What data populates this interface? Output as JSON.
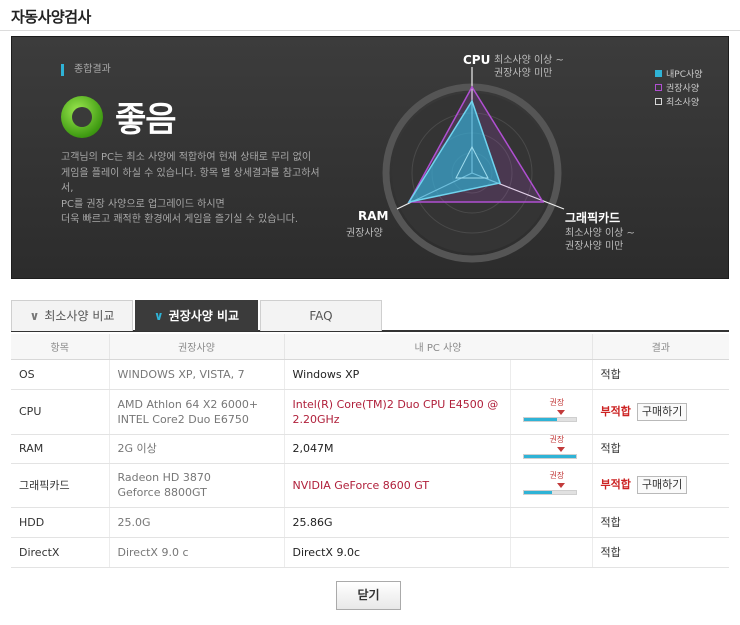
{
  "page_title": "자동사양검사",
  "summary": {
    "label": "종합결과",
    "result": "좋음",
    "description": "고객님의 PC는 최소 사양에 적합하여 현재 상태로 무리 없이\n게임을 플레이 하실 수 있습니다. 항목 별 상세결과를 참고하셔서,\nPC를 권장 사양으로 업그레이드 하시면\n더욱 빠르고 쾌적한 환경에서 게임을 즐기실 수 있습니다."
  },
  "radar": {
    "axes": [
      {
        "name": "CPU",
        "note": "최소사양 이상 ~\n권장사양 미만"
      },
      {
        "name": "그래픽카드",
        "note": "최소사양 이상 ~\n권장사양 미만"
      },
      {
        "name": "RAM",
        "note": "권장사양"
      }
    ],
    "legend": [
      {
        "label": "내PC사양",
        "color": "#2fb3d6"
      },
      {
        "label": "권장사양",
        "color": "#b04fd2"
      },
      {
        "label": "최소사양",
        "color": "#d8d8d8"
      }
    ]
  },
  "tabs": [
    {
      "label": "최소사양 비교"
    },
    {
      "label": "권장사양 비교"
    },
    {
      "label": "FAQ"
    }
  ],
  "table": {
    "headers": {
      "item": "항목",
      "recommended": "권장사양",
      "mine": "내 PC 사양",
      "result": "결과"
    },
    "rows": [
      {
        "item": "OS",
        "recommended": "WINDOWS XP,  VISTA,  7",
        "mine": "Windows XP",
        "meter": false,
        "result": "적합",
        "buy": ""
      },
      {
        "item": "CPU",
        "recommended": "AMD Athlon 64 X2 6000+\nINTEL Core2 Duo E6750",
        "mine": "Intel(R) Core(TM)2 Duo CPU E4500 @\n2.20GHz",
        "meter": true,
        "meter_label": "권장",
        "meter_level": 0.65,
        "result": "부적합",
        "buy": "구매하기"
      },
      {
        "item": "RAM",
        "recommended": "2G 이상",
        "mine": "2,047M",
        "meter": true,
        "meter_label": "권장",
        "meter_level": 1.0,
        "result": "적합",
        "buy": ""
      },
      {
        "item": "그래픽카드",
        "recommended": "Radeon HD 3870\nGeforce 8800GT",
        "mine": "NVIDIA GeForce 8600 GT",
        "meter": true,
        "meter_label": "권장",
        "meter_level": 0.55,
        "result": "부적합",
        "buy": "구매하기"
      },
      {
        "item": "HDD",
        "recommended": "25.0G",
        "mine": "25.86G",
        "meter": false,
        "result": "적합",
        "buy": ""
      },
      {
        "item": "DirectX",
        "recommended": "DirectX 9.0 c",
        "mine": "DirectX 9.0c",
        "meter": false,
        "result": "적합",
        "buy": ""
      }
    ]
  },
  "close_label": "닫기"
}
